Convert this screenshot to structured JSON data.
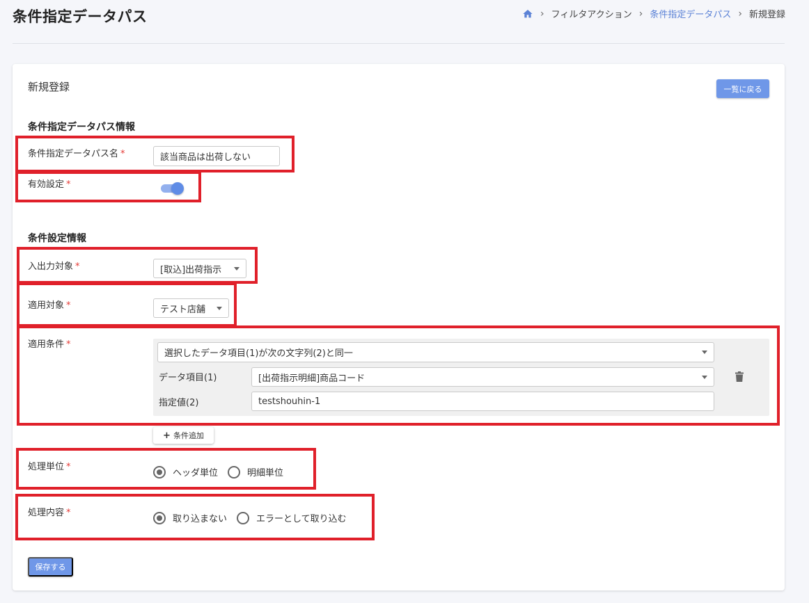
{
  "header": {
    "title": "条件指定データパス",
    "breadcrumb": [
      "フィルタアクション",
      "条件指定データパス",
      "新規登録"
    ]
  },
  "card": {
    "title": "新規登録",
    "back_label": "一覧に戻る"
  },
  "section1": {
    "title": "条件指定データパス情報",
    "name_label": "条件指定データパス名",
    "name_value": "該当商品は出荷しない",
    "enabled_label": "有効設定",
    "enabled": true
  },
  "section2": {
    "title": "条件設定情報",
    "io_label": "入出力対象",
    "io_value": "[取込]出荷指示",
    "target_label": "適用対象",
    "target_value": "テスト店舗",
    "condition_label": "適用条件",
    "condition_type": "選択したデータ項目(1)が次の文字列(2)と同一",
    "data_item_label": "データ項目(1)",
    "data_item_value": "[出荷指示明細]商品コード",
    "value_label": "指定値(2)",
    "value_value": "testshouhin-1",
    "add_condition": "条件追加",
    "unit_label": "処理単位",
    "unit_options": [
      "ヘッダ単位",
      "明細単位"
    ],
    "unit_selected": "ヘッダ単位",
    "action_label": "処理内容",
    "action_options": [
      "取り込まない",
      "エラーとして取り込む"
    ],
    "action_selected": "取り込まない",
    "required_mark": "*"
  },
  "save_label": "保存する",
  "colors": {
    "accent": "#6f97e8",
    "link": "#5b82d6",
    "required": "#e53935",
    "highlight": "#e0202a"
  }
}
